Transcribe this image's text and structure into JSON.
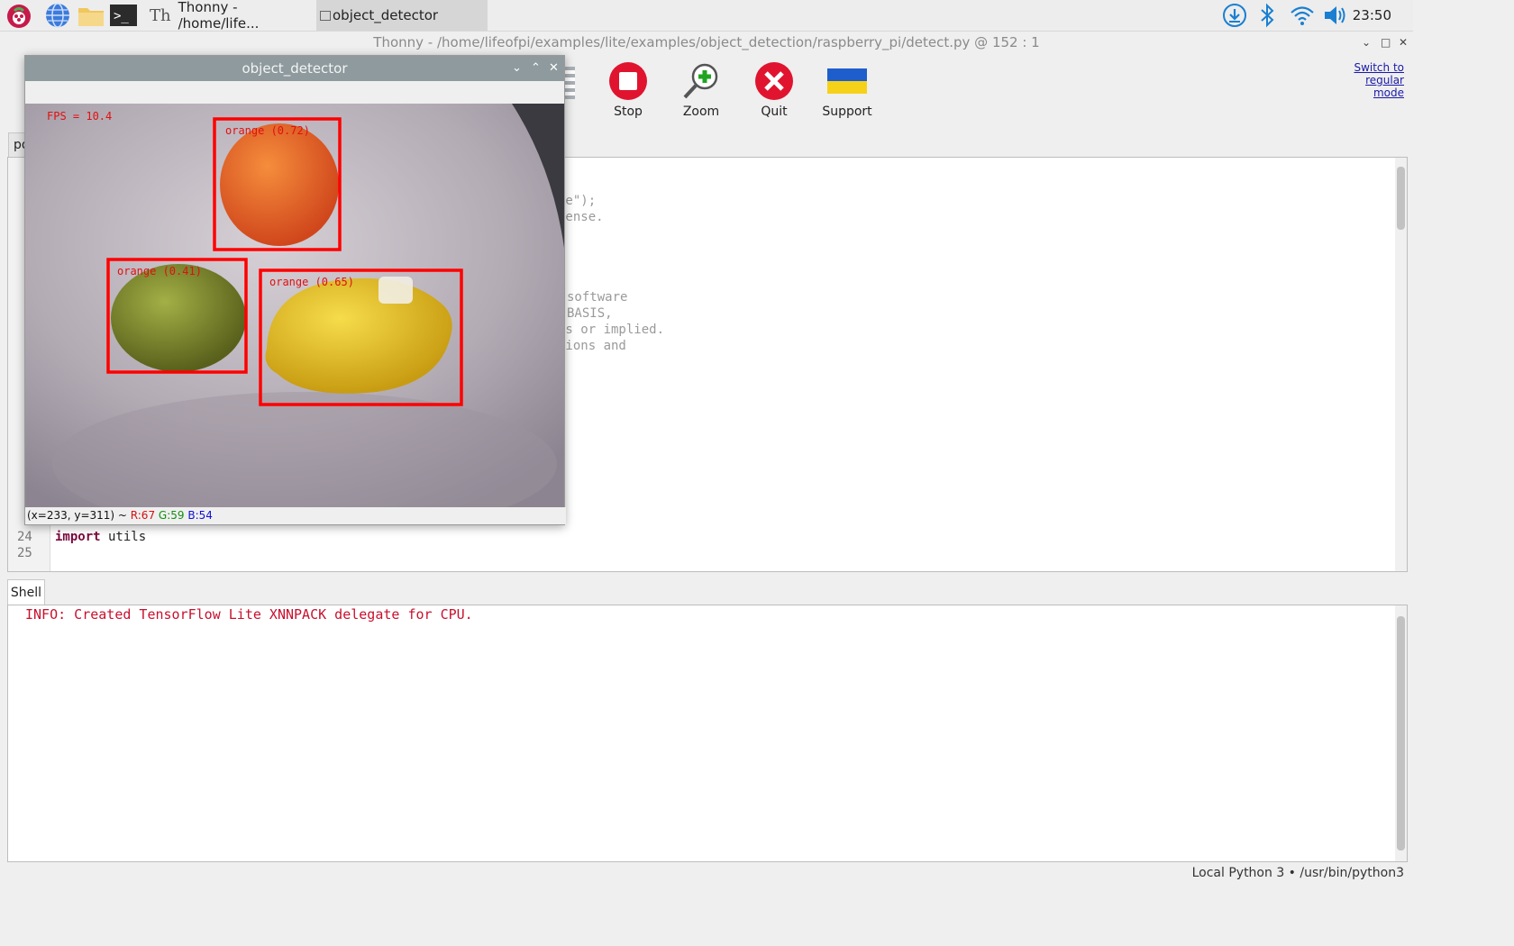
{
  "taskbar": {
    "tasks": [
      {
        "label": "Thonny  -  /home/life..."
      },
      {
        "label": "object_detector"
      }
    ],
    "clock": "23:50"
  },
  "thonny": {
    "title": "Thonny  -  /home/lifeofpi/examples/lite/examples/object_detection/raspberry_pi/detect.py  @  152 : 1",
    "toolbar": {
      "stop": "Stop",
      "zoom": "Zoom",
      "quit": "Quit",
      "support": "Support",
      "switch_mode": [
        "Switch to",
        "regular",
        "mode"
      ]
    },
    "editor": {
      "tab_label": "po",
      "visible_code_fragments": [
        "se\");",
        "cense.",
        "software",
        "BASIS,",
        "ss or implied.",
        "sions and"
      ],
      "line_numbers": [
        "24",
        "25"
      ],
      "line24": {
        "keyword": "import",
        "rest": " utils"
      }
    },
    "shell": {
      "tab_label": "Shell",
      "output": "INFO: Created TensorFlow Lite XNNPACK delegate for CPU."
    },
    "status": "Local Python 3  •  /usr/bin/python3"
  },
  "object_detector": {
    "title": "object_detector",
    "fps": "FPS = 10.4",
    "detections": [
      {
        "label": "orange (0.72)"
      },
      {
        "label": "orange (0.41)"
      },
      {
        "label": "orange (0.65)"
      }
    ],
    "status": {
      "coords": "(x=233, y=311) ~ ",
      "r": "R:67",
      "g": "G:59",
      "b": "B:54"
    }
  },
  "colors": {
    "accent_red": "#e0142e",
    "stop_red": "#e0142e",
    "link_blue": "#1a1aa8"
  },
  "icons": [
    "raspberry-icon",
    "globe-icon",
    "folder-icon",
    "terminal-icon",
    "download-icon",
    "bluetooth-icon",
    "wifi-icon",
    "volume-icon"
  ]
}
